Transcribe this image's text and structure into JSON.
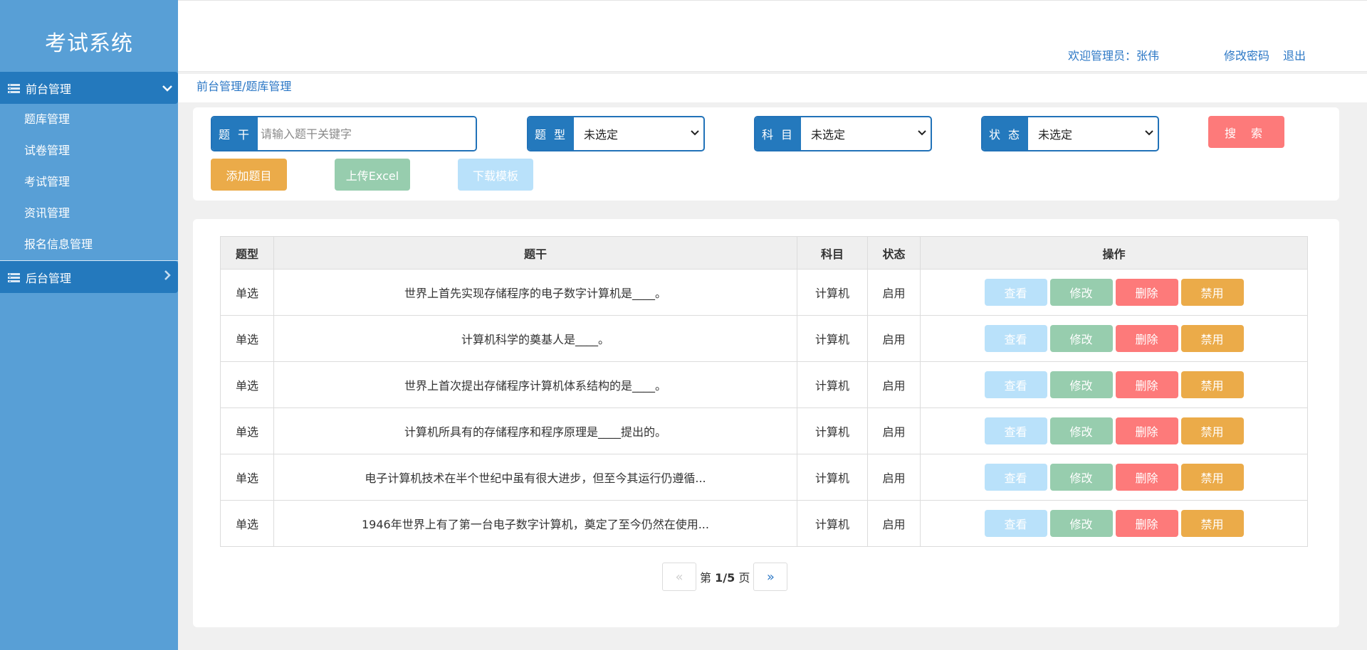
{
  "app": {
    "title": "考试系统"
  },
  "sidebar": {
    "groups": [
      {
        "label": "前台管理",
        "expanded": true
      },
      {
        "label": "后台管理",
        "expanded": false
      }
    ],
    "items": [
      {
        "label": "题库管理"
      },
      {
        "label": "试卷管理"
      },
      {
        "label": "考试管理"
      },
      {
        "label": "资讯管理"
      },
      {
        "label": "报名信息管理"
      }
    ]
  },
  "header": {
    "welcome": "欢迎管理员：张伟",
    "change_password": "修改密码",
    "logout": "退出"
  },
  "breadcrumb": "前台管理/题库管理",
  "filters": {
    "stem": {
      "label": "题 干",
      "placeholder": "请输入题干关键字"
    },
    "type": {
      "label": "题 型",
      "value": "未选定"
    },
    "subject": {
      "label": "科 目",
      "value": "未选定"
    },
    "status": {
      "label": "状 态",
      "value": "未选定"
    },
    "search_button": "搜 索"
  },
  "actions": {
    "add": "添加题目",
    "upload": "上传Excel",
    "download": "下载模板"
  },
  "table": {
    "headers": [
      "题型",
      "题干",
      "科目",
      "状态",
      "操作"
    ],
    "ops": {
      "view": "查看",
      "edit": "修改",
      "delete": "删除",
      "disable": "禁用"
    },
    "rows": [
      {
        "type": "单选",
        "stem": "世界上首先实现存储程序的电子数字计算机是____。",
        "subject": "计算机",
        "status": "启用"
      },
      {
        "type": "单选",
        "stem": "计算机科学的奠基人是____。",
        "subject": "计算机",
        "status": "启用"
      },
      {
        "type": "单选",
        "stem": "世界上首次提出存储程序计算机体系结构的是____。",
        "subject": "计算机",
        "status": "启用"
      },
      {
        "type": "单选",
        "stem": "计算机所具有的存储程序和程序原理是____提出的。",
        "subject": "计算机",
        "status": "启用"
      },
      {
        "type": "单选",
        "stem": "电子计算机技术在半个世纪中虽有很大进步，但至今其运行仍遵循...",
        "subject": "计算机",
        "status": "启用"
      },
      {
        "type": "单选",
        "stem": "1946年世界上有了第一台电子数字计算机，奠定了至今仍然在使用...",
        "subject": "计算机",
        "status": "启用"
      }
    ]
  },
  "pager": {
    "prev": "«",
    "next": "»",
    "prefix": "第",
    "current": "1",
    "separator": "/",
    "total": "5",
    "suffix": "页"
  }
}
